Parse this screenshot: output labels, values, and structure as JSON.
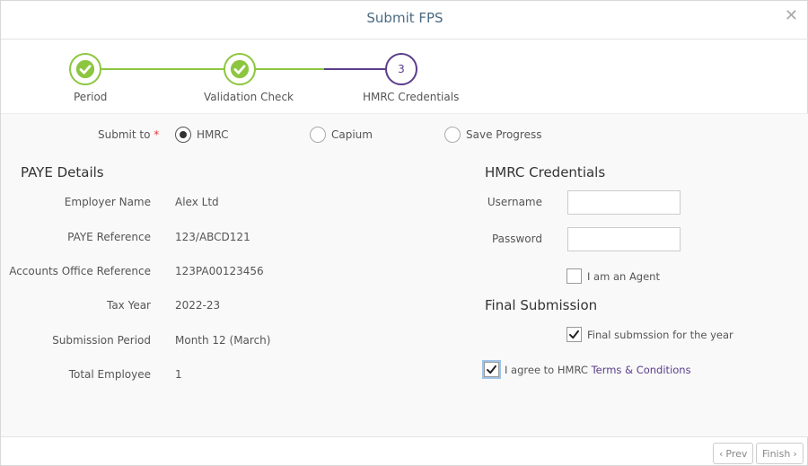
{
  "header": {
    "title": "Submit FPS",
    "close": "✕"
  },
  "steps": [
    {
      "label": "Period",
      "state": "done"
    },
    {
      "label": "Validation Check",
      "state": "done"
    },
    {
      "label": "HMRC Credentials",
      "state": "active",
      "number": "3"
    }
  ],
  "submit_to": {
    "label": "Submit to",
    "required_mark": "*",
    "options": [
      "HMRC",
      "Capium",
      "Save Progress"
    ],
    "selected": "HMRC"
  },
  "paye": {
    "title": "PAYE Details",
    "fields": [
      {
        "label": "Employer Name",
        "value": "Alex Ltd"
      },
      {
        "label": "PAYE Reference",
        "value": "123/ABCD121"
      },
      {
        "label": "Accounts Office Reference",
        "value": "123PA00123456"
      },
      {
        "label": "Tax Year",
        "value": "2022-23"
      },
      {
        "label": "Submission Period",
        "value": "Month 12 (March)"
      },
      {
        "label": "Total Employee",
        "value": "1"
      }
    ]
  },
  "credentials": {
    "title": "HMRC Credentials",
    "username_label": "Username",
    "username_value": "",
    "password_label": "Password",
    "password_value": "",
    "agent_label": "I am an Agent",
    "agent_checked": false
  },
  "final": {
    "title": "Final Submission",
    "final_label": "Final submssion for the year",
    "final_checked": true,
    "agree_prefix": "I agree to HMRC",
    "agree_link": "Terms & Conditions",
    "agree_checked": true
  },
  "footer": {
    "prev": "Prev",
    "finish": "Finish"
  },
  "colors": {
    "green": "#8cc63f",
    "purple": "#5a3d8a",
    "title": "#4a6a82"
  }
}
